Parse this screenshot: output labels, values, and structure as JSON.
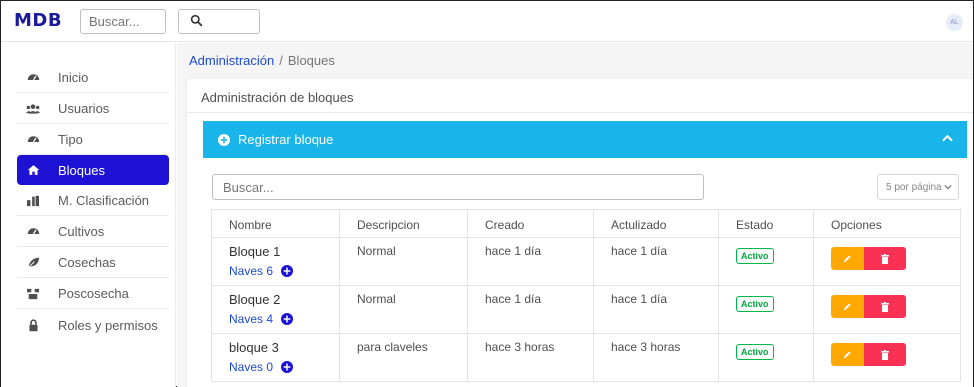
{
  "app": {
    "logo": "MDB",
    "avatar": "AL"
  },
  "topbar": {
    "search_placeholder": "Buscar..."
  },
  "sidebar": {
    "items": [
      {
        "label": "Inicio",
        "icon": "dashboard-icon"
      },
      {
        "label": "Usuarios",
        "icon": "users-icon"
      },
      {
        "label": "Tipo",
        "icon": "dashboard-icon"
      },
      {
        "label": "Bloques",
        "icon": "home-icon",
        "active": true
      },
      {
        "label": "M. Clasificación",
        "icon": "classification-icon"
      },
      {
        "label": "Cultivos",
        "icon": "dashboard-icon"
      },
      {
        "label": "Cosechas",
        "icon": "leaf-icon"
      },
      {
        "label": "Poscosecha",
        "icon": "tools-icon"
      },
      {
        "label": "Roles y permisos",
        "icon": "lock-icon"
      }
    ],
    "active_color": "#1e13d4"
  },
  "breadcrumb": {
    "parent": "Administración",
    "separator": "/",
    "current": "Bloques"
  },
  "card": {
    "title": "Administración de bloques"
  },
  "register": {
    "label": "Registrar bloque",
    "color": "#18b4ea"
  },
  "table_tools": {
    "search_placeholder": "Buscar...",
    "per_page": "5 por página"
  },
  "table": {
    "headers": [
      "Nombre",
      "Descripcion",
      "Creado",
      "Actulizado",
      "Estado",
      "Opciones"
    ],
    "rows": [
      {
        "nombre": "Bloque 1",
        "naves": "Naves 6",
        "descripcion": "Normal",
        "creado": "hace 1 día",
        "actualizado": "hace 1 día",
        "estado": "Activo"
      },
      {
        "nombre": "Bloque 2",
        "naves": "Naves 4",
        "descripcion": "Normal",
        "creado": "hace 1 día",
        "actualizado": "hace 1 día",
        "estado": "Activo"
      },
      {
        "nombre": "bloque 3",
        "naves": "Naves 0",
        "descripcion": "para claveles",
        "creado": "hace 3 horas",
        "actualizado": "hace 3 horas",
        "estado": "Activo"
      }
    ]
  },
  "colors": {
    "edit": "#ffa900",
    "delete": "#f93154",
    "status": "#00b74a",
    "link": "#1e4bd1"
  }
}
